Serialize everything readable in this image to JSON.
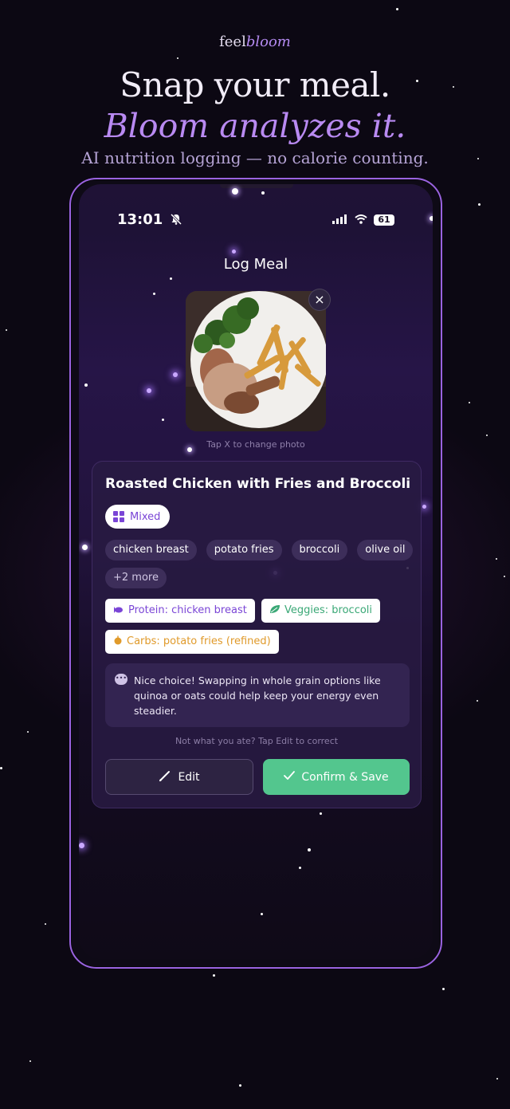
{
  "brand": {
    "part1": "feel",
    "part2": "bloom"
  },
  "hero": {
    "line1": "Snap your meal.",
    "line2": "Bloom analyzes it.",
    "subtitle": "AI nutrition logging — no calorie counting."
  },
  "status_bar": {
    "time": "13:01",
    "battery": "61"
  },
  "screen": {
    "title": "Log Meal",
    "close_icon": "×",
    "photo_hint": "Tap X to change photo"
  },
  "meal": {
    "name": "Roasted Chicken with Fries and Broccoli",
    "category": "Mixed",
    "ingredients": [
      "chicken breast",
      "potato fries",
      "broccoli",
      "olive oil"
    ],
    "more": "+2 more",
    "tags": {
      "protein": "Protein: chicken breast",
      "veggies": "Veggies: broccoli",
      "carbs": "Carbs: potato fries (refined)"
    },
    "tip": "Nice choice! Swapping in whole grain options like quinoa or oats could help keep your energy even steadier.",
    "correction_hint": "Not what you ate? Tap Edit to correct"
  },
  "actions": {
    "edit": "Edit",
    "confirm": "Confirm & Save"
  },
  "colors": {
    "accent_purple": "#b98af2",
    "phone_border": "#9a63e0",
    "confirm_green": "#53c68e",
    "protein": "#7a45d6",
    "veggies": "#3aa876",
    "carbs": "#e09a2a"
  }
}
